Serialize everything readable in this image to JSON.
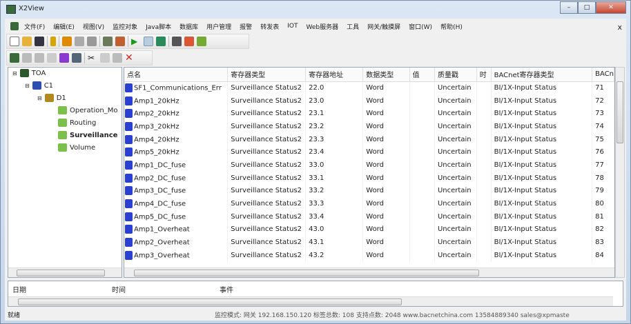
{
  "window": {
    "title": "X2View",
    "minimize": "–",
    "maximize": "□",
    "close": "✕"
  },
  "menu": [
    "文件(F)",
    "编辑(E)",
    "视图(V)",
    "监控对象",
    "Java脚本",
    "数据库",
    "用户管理",
    "报警",
    "转发表",
    "IOT",
    "Web服务器",
    "工具",
    "网关/触摸屏",
    "窗口(W)",
    "帮助(H)"
  ],
  "mdi_close": "x",
  "tree": {
    "root": "TOA",
    "channel": "C1",
    "device": "D1",
    "groups": [
      "Operation_Mo",
      "Routing",
      "Surveillance",
      "Volume"
    ],
    "selected": "Surveillance"
  },
  "table": {
    "columns": [
      "点名",
      "寄存器类型",
      "寄存器地址",
      "数据类型",
      "值",
      "质量戳",
      "时",
      "BACnet寄存器类型",
      "BACn"
    ],
    "rows": [
      [
        "SF1_Communications_Err",
        "Surveillance Status2",
        "22.0",
        "Word",
        "",
        "Uncertain",
        "",
        "BI/1X-Input Status",
        "71"
      ],
      [
        "Amp1_20kHz",
        "Surveillance Status2",
        "23.0",
        "Word",
        "",
        "Uncertain",
        "",
        "BI/1X-Input Status",
        "72"
      ],
      [
        "Amp2_20kHz",
        "Surveillance Status2",
        "23.1",
        "Word",
        "",
        "Uncertain",
        "",
        "BI/1X-Input Status",
        "73"
      ],
      [
        "Amp3_20kHz",
        "Surveillance Status2",
        "23.2",
        "Word",
        "",
        "Uncertain",
        "",
        "BI/1X-Input Status",
        "74"
      ],
      [
        "Amp4_20kHz",
        "Surveillance Status2",
        "23.3",
        "Word",
        "",
        "Uncertain",
        "",
        "BI/1X-Input Status",
        "75"
      ],
      [
        "Amp5_20kHz",
        "Surveillance Status2",
        "23.4",
        "Word",
        "",
        "Uncertain",
        "",
        "BI/1X-Input Status",
        "76"
      ],
      [
        "Amp1_DC_fuse",
        "Surveillance Status2",
        "33.0",
        "Word",
        "",
        "Uncertain",
        "",
        "BI/1X-Input Status",
        "77"
      ],
      [
        "Amp2_DC_fuse",
        "Surveillance Status2",
        "33.1",
        "Word",
        "",
        "Uncertain",
        "",
        "BI/1X-Input Status",
        "78"
      ],
      [
        "Amp3_DC_fuse",
        "Surveillance Status2",
        "33.2",
        "Word",
        "",
        "Uncertain",
        "",
        "BI/1X-Input Status",
        "79"
      ],
      [
        "Amp4_DC_fuse",
        "Surveillance Status2",
        "33.3",
        "Word",
        "",
        "Uncertain",
        "",
        "BI/1X-Input Status",
        "80"
      ],
      [
        "Amp5_DC_fuse",
        "Surveillance Status2",
        "33.4",
        "Word",
        "",
        "Uncertain",
        "",
        "BI/1X-Input Status",
        "81"
      ],
      [
        "Amp1_Overheat",
        "Surveillance Status2",
        "43.0",
        "Word",
        "",
        "Uncertain",
        "",
        "BI/1X-Input Status",
        "82"
      ],
      [
        "Amp2_Overheat",
        "Surveillance Status2",
        "43.1",
        "Word",
        "",
        "Uncertain",
        "",
        "BI/1X-Input Status",
        "83"
      ],
      [
        "Amp3_Overheat",
        "Surveillance Status2",
        "43.2",
        "Word",
        "",
        "Uncertain",
        "",
        "BI/1X-Input Status",
        "84"
      ]
    ]
  },
  "events": {
    "columns": [
      "日期",
      "时间",
      "事件"
    ]
  },
  "status": {
    "ready": "就绪",
    "info": "监控模式: 网关 192.168.150.120 标签总数: 108    支持点数: 2048    www.bacnetchina.com 13584889340 sales@xpmaste"
  }
}
